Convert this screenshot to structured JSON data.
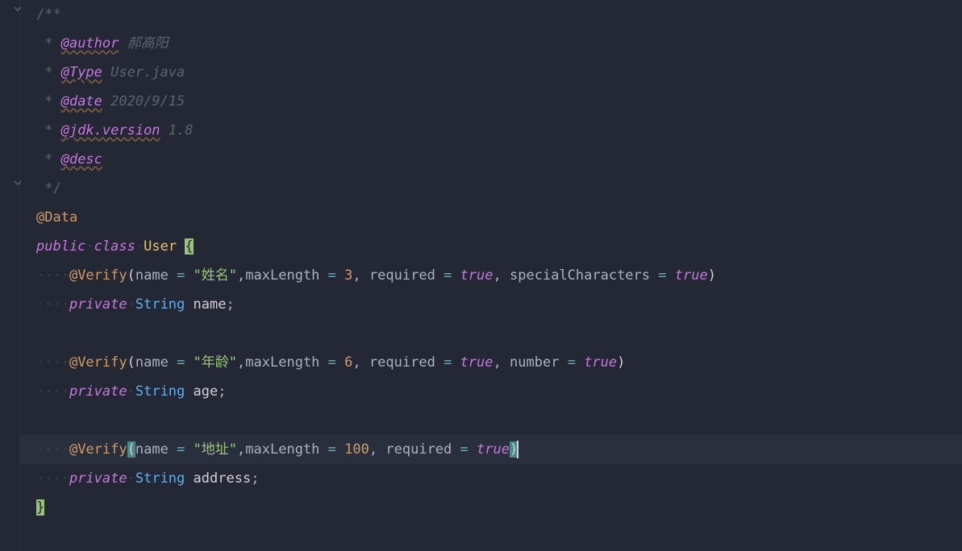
{
  "javadoc": {
    "open": "/**",
    "star": " * ",
    "author_tag": "@author",
    "author_val": " 郝高阳",
    "type_tag": "@Type",
    "type_val": " User.java",
    "date_tag": "@date",
    "date_val": " 2020/9/15",
    "jdk_tag": "@jdk.version",
    "jdk_val": " 1.8",
    "desc_tag": "@desc",
    "close": " */"
  },
  "annotations": {
    "data": "@Data",
    "verify": "@Verify"
  },
  "keywords": {
    "public": "public",
    "class": "class",
    "private": "private"
  },
  "class_name": "User",
  "types": {
    "string": "String"
  },
  "params": {
    "name": "name",
    "maxLength": "maxLength",
    "required": "required",
    "specialCharacters": "specialCharacters",
    "number": "number"
  },
  "fields": {
    "name": "name",
    "age": "age",
    "address": "address"
  },
  "values": {
    "name_str": "\"姓名\"",
    "age_str": "\"年龄\"",
    "address_str": "\"地址\"",
    "three": "3",
    "six": "6",
    "hundred": "100",
    "true": "true"
  },
  "ws": {
    "dot": "·",
    "indent1": "····",
    "indent2": "········"
  }
}
